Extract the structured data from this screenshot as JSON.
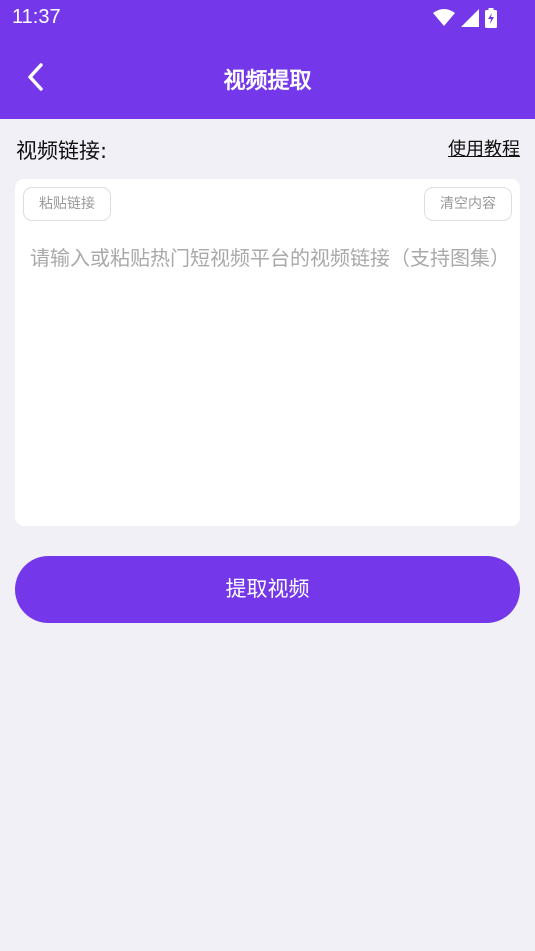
{
  "status_bar": {
    "time": "11:37",
    "icons": [
      "wifi-icon",
      "signal-icon",
      "battery-charging-icon"
    ]
  },
  "app_bar": {
    "title": "视频提取",
    "back_icon": "chevron-left-icon"
  },
  "form": {
    "label": "视频链接:",
    "tutorial_link": "使用教程",
    "paste_button": "粘贴链接",
    "clear_button": "清空内容",
    "input_value": "",
    "input_placeholder": "请输入或粘贴热门短视频平台的视频链接（支持图集）"
  },
  "actions": {
    "extract_button": "提取视频"
  },
  "colors": {
    "primary": "#7438ea",
    "background": "#f1f0f6",
    "card": "#ffffff",
    "placeholder": "#a9a9a9"
  }
}
